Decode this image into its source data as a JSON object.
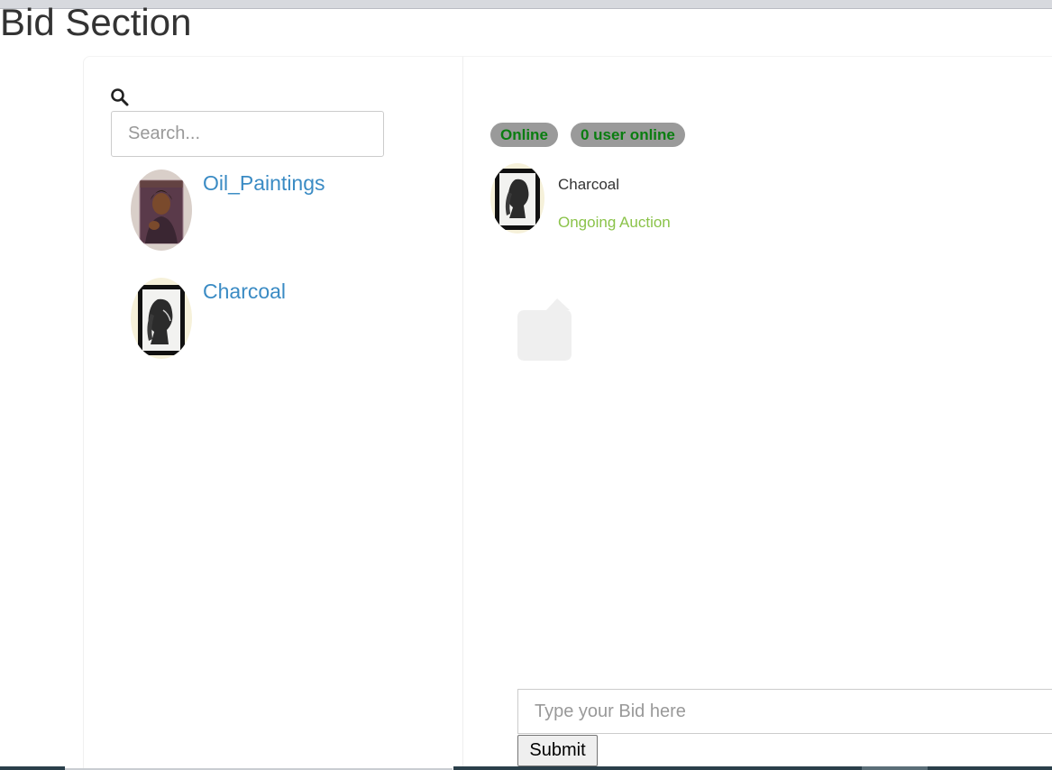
{
  "page": {
    "title": "Bid Section"
  },
  "search": {
    "placeholder": "Search..."
  },
  "artworks": [
    {
      "name": "Oil_Paintings"
    },
    {
      "name": "Charcoal"
    }
  ],
  "status": {
    "online_label": "Online",
    "users_online": "0 user online"
  },
  "active_auction": {
    "title": "Charcoal",
    "status": "Ongoing Auction"
  },
  "bid": {
    "placeholder": "Type your Bid here",
    "submit_label": "Submit"
  },
  "colors": {
    "link": "#3a8bc4",
    "badge_bg": "#9a9a9a",
    "badge_text": "#0a7d10",
    "auction_status": "#8bc34a"
  }
}
